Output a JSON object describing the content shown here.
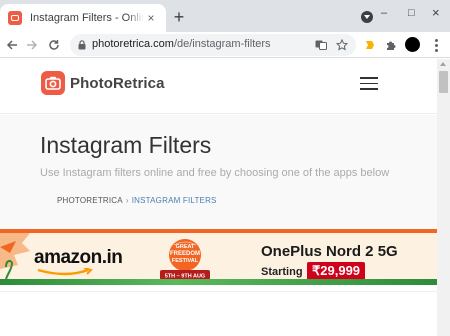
{
  "browser": {
    "tab": {
      "title": "Instagram Filters - Online and Free",
      "close_glyph": "×",
      "favicon": "camera-icon"
    },
    "new_tab_glyph": "+",
    "window_controls": {
      "minimize": "–",
      "maximize": "□",
      "close": "×"
    },
    "url": {
      "host": "photoretrica.com",
      "path": "/de/instagram-filters"
    }
  },
  "site": {
    "logo_text": "PhotoRetrica",
    "brand_color": "#ee5c45"
  },
  "page": {
    "title": "Instagram Filters",
    "subtitle": "Use Instagram filters online and free by choosing one of the apps below",
    "breadcrumb": {
      "home": "PHOTORETRICA",
      "separator": "›",
      "current": "INSTAGRAM FILTERS"
    }
  },
  "ad": {
    "brand": "amazon.in",
    "badge": {
      "line1": "GREAT",
      "line2": "FREEDOM",
      "line3": "FESTIVAL",
      "dates": "5TH – 9TH AUG"
    },
    "product": "OnePlus Nord 2 5G",
    "starting_label": "Starting",
    "price": "₹29,999"
  }
}
